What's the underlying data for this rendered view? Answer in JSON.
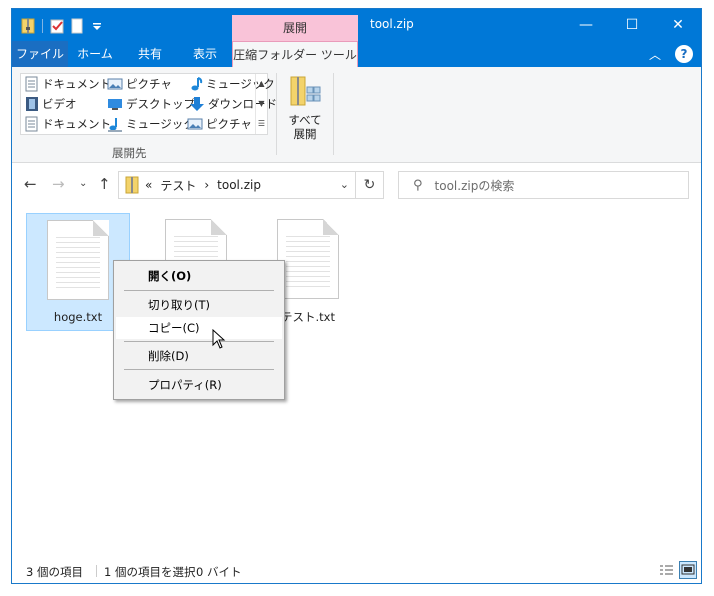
{
  "window": {
    "title": "tool.zip",
    "context_tab_label": "展開"
  },
  "window_buttons": {
    "minimize": "—",
    "maximize": "☐",
    "close": "✕"
  },
  "tabs": [
    {
      "label": "ファイル"
    },
    {
      "label": "ホーム"
    },
    {
      "label": "共有"
    },
    {
      "label": "表示"
    },
    {
      "label": "圧縮フォルダー ツール"
    }
  ],
  "ribbon": {
    "gallery": [
      {
        "label": "ドキュメント",
        "icon": "document-icon"
      },
      {
        "label": "ピクチャ",
        "icon": "pictures-icon"
      },
      {
        "label": "ミュージック",
        "icon": "music-icon"
      },
      {
        "label": "ビデオ",
        "icon": "video-icon"
      },
      {
        "label": "デスクトップ",
        "icon": "desktop-icon"
      },
      {
        "label": "ダウンロード",
        "icon": "download-icon"
      },
      {
        "label": "ドキュメント",
        "icon": "document-icon"
      },
      {
        "label": "ミュージック",
        "icon": "music-icon"
      },
      {
        "label": "ピクチャ",
        "icon": "pictures-icon"
      }
    ],
    "group_label": "展開先",
    "extract_all_line1": "すべて",
    "extract_all_line2": "展開"
  },
  "address": {
    "prefix": "«",
    "crumb1": "テスト",
    "crumb2": "tool.zip"
  },
  "search": {
    "placeholder": "tool.zipの検索"
  },
  "files": [
    {
      "name": "hoge.txt",
      "selected": true
    },
    {
      "name": "",
      "selected": false
    },
    {
      "name": "テスト.txt",
      "selected": false
    }
  ],
  "context_menu": {
    "open": "開く(O)",
    "cut": "切り取り(T)",
    "copy": "コピー(C)",
    "delete": "削除(D)",
    "properties": "プロパティ(R)"
  },
  "status": {
    "count": "3 個の項目",
    "selection": "1 個の項目を選択",
    "size": "0 バイト"
  },
  "colors": {
    "accent": "#0078d7",
    "context_tab": "#f9c3d8",
    "selection": "#cce8ff"
  }
}
